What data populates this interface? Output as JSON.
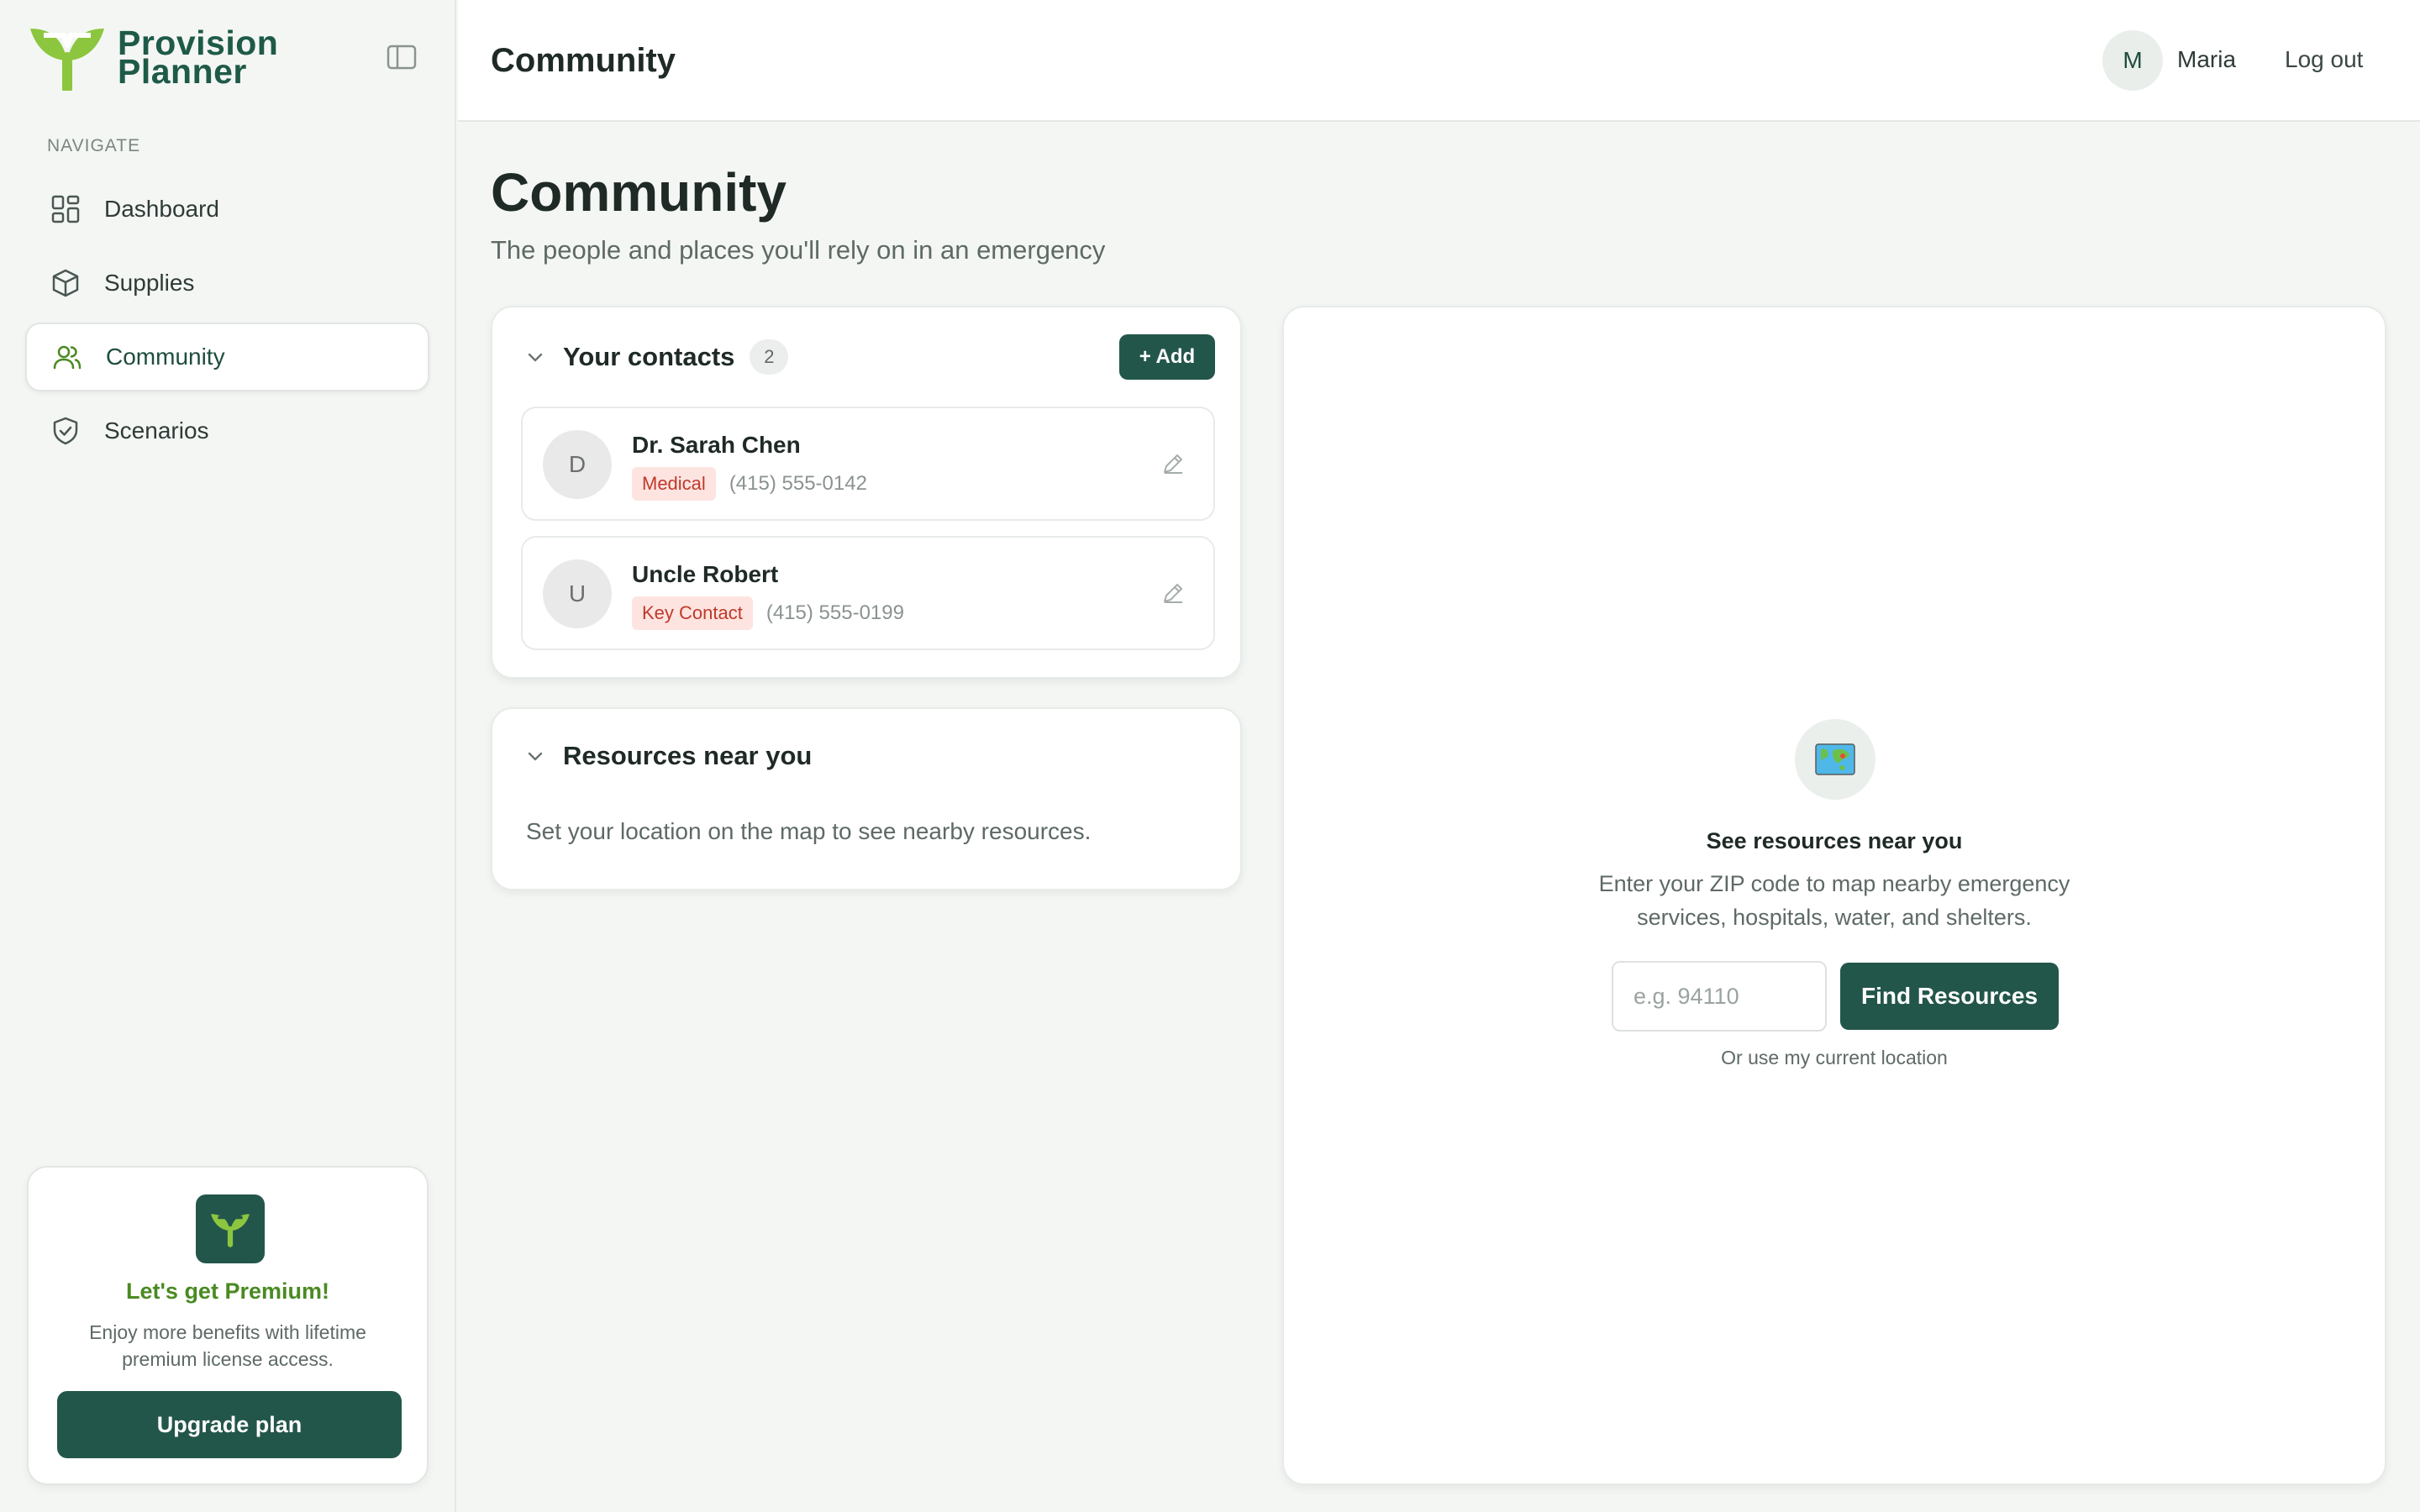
{
  "brand": {
    "line1": "Provision",
    "line2": "Planner",
    "color": "#1e5a48",
    "accent": "#8cc63f"
  },
  "sidebar": {
    "heading": "NAVIGATE",
    "items": [
      {
        "label": "Dashboard",
        "icon": "grid-icon",
        "active": false
      },
      {
        "label": "Supplies",
        "icon": "box-icon",
        "active": false
      },
      {
        "label": "Community",
        "icon": "users-icon",
        "active": true
      },
      {
        "label": "Scenarios",
        "icon": "shield-check-icon",
        "active": false
      }
    ],
    "premium": {
      "title": "Let's get Premium!",
      "description": "Enjoy more benefits with lifetime premium license access.",
      "button": "Upgrade plan"
    }
  },
  "topbar": {
    "title": "Community",
    "user_initial": "M",
    "user_name": "Maria",
    "logout": "Log out"
  },
  "main": {
    "heading": "Community",
    "subtitle": "The people and places you'll rely on in an emergency",
    "contacts": {
      "title": "Your contacts",
      "count": "2",
      "add_label": "+ Add",
      "items": [
        {
          "initial": "D",
          "name": "Dr. Sarah Chen",
          "tag": "Medical",
          "phone": "(415) 555-0142"
        },
        {
          "initial": "U",
          "name": "Uncle Robert",
          "tag": "Key Contact",
          "phone": "(415) 555-0199"
        }
      ]
    },
    "resources": {
      "title": "Resources near you",
      "empty_text": "Set your location on the map to see nearby resources."
    },
    "map_panel": {
      "icon": "world-map-icon",
      "title": "See resources near you",
      "description": "Enter your ZIP code to map nearby emergency services, hospitals, water, and shelters.",
      "zip_placeholder": "e.g. 94110",
      "zip_value": "",
      "find_button": "Find Resources",
      "current_location": "Or use my current location"
    }
  },
  "colors": {
    "primary_button": "#23564a",
    "tag_bg": "#fde4e0",
    "tag_text": "#c0392b",
    "premium_title": "#4a8a22"
  }
}
